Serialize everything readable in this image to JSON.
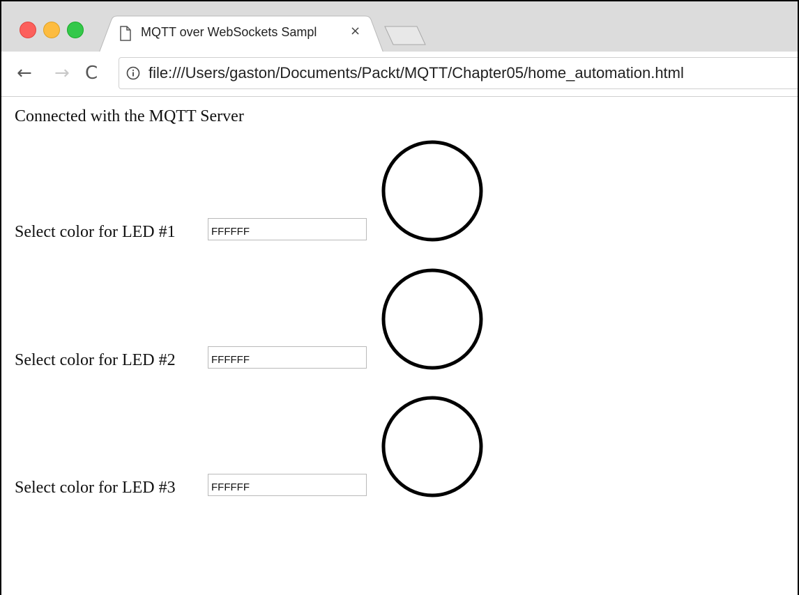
{
  "browser": {
    "tab_title": "MQTT over WebSockets Sampl",
    "tab_close_glyph": "×",
    "url": "file:///Users/gaston/Documents/Packt/MQTT/Chapter05/home_automation.html",
    "nav": {
      "back_glyph": "←",
      "forward_glyph": "→",
      "reload_glyph": "C"
    }
  },
  "page": {
    "status_text": "Connected with the MQTT Server",
    "leds": [
      {
        "label": "Select color for LED #1",
        "value": "FFFFFF",
        "fill_color": "#FFFFFF"
      },
      {
        "label": "Select color for LED #2",
        "value": "FFFFFF",
        "fill_color": "#FFFFFF"
      },
      {
        "label": "Select color for LED #3",
        "value": "FFFFFF",
        "fill_color": "#FFFFFF"
      }
    ]
  },
  "colors": {
    "traffic_red": "#fc605c",
    "traffic_yellow": "#fdbc40",
    "traffic_green": "#34c84a",
    "tabstrip_bg": "#dcdcdc"
  }
}
